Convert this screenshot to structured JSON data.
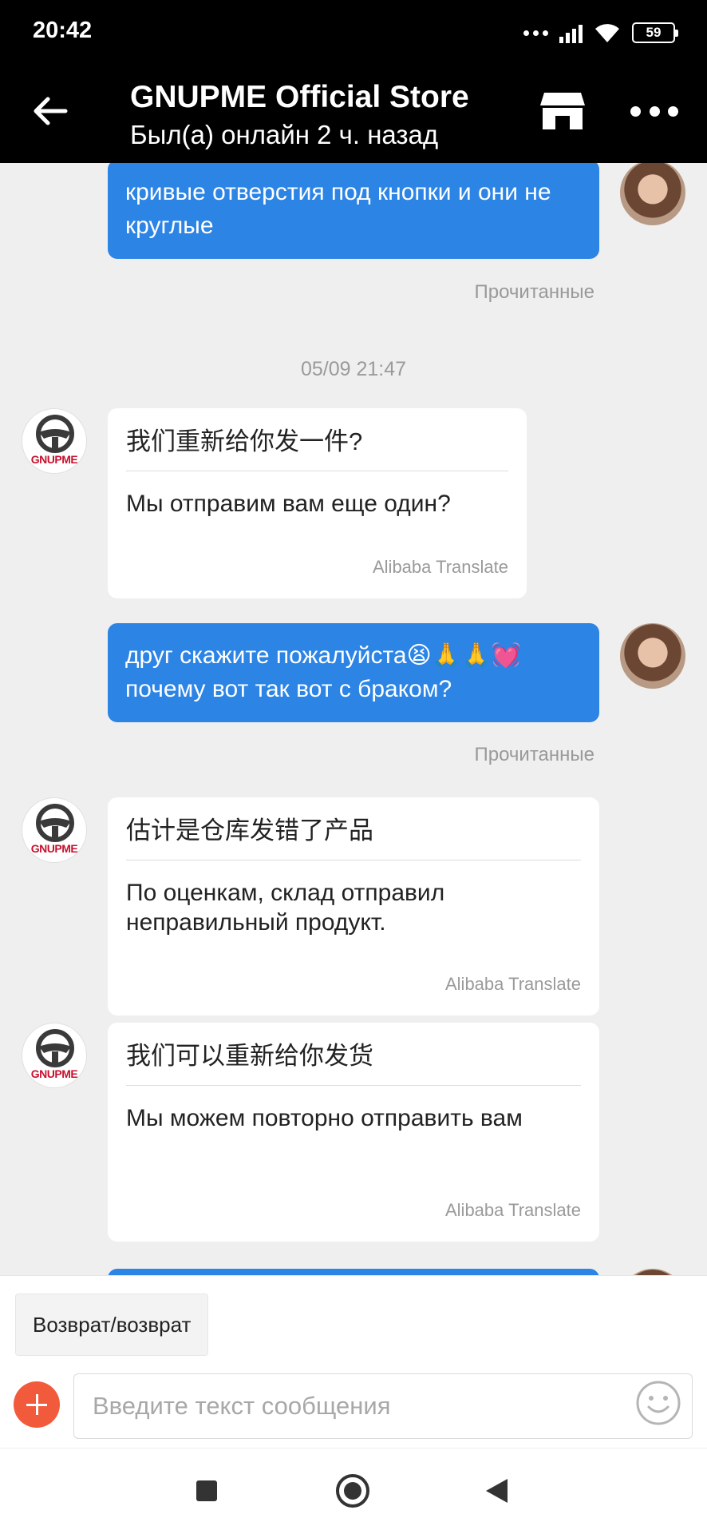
{
  "status_bar": {
    "time": "20:42",
    "battery": "59"
  },
  "header": {
    "title": "GNUPME Official Store",
    "subtitle": "Был(а) онлайн 2 ч. назад"
  },
  "store_brand": "GNUPME",
  "messages": [
    {
      "from": "user",
      "text": "кривые отверстия под кнопки и они не круглые",
      "status": "Прочитанные"
    },
    {
      "type": "timestamp",
      "text": "05/09 21:47"
    },
    {
      "from": "store",
      "original": "我们重新给你发一件?",
      "translation": "Мы отправим вам еще один?",
      "source": "Alibaba Translate"
    },
    {
      "from": "user",
      "text": "друг скажите пожалуйста😫🙏🙏💓 почему вот так вот с браком?",
      "status": "Прочитанные"
    },
    {
      "from": "store",
      "original": "估计是仓库发错了产品",
      "translation": "По оценкам, склад отправил неправильный продукт.",
      "source": "Alibaba Translate"
    },
    {
      "from": "store",
      "original": "我们可以重新给你发货",
      "translation": "Мы можем повторно отправить вам",
      "source": "Alibaba Translate"
    }
  ],
  "quick_reply": "Возврат/возврат",
  "input": {
    "placeholder": "Введите текст сообщения",
    "value": ""
  },
  "icons": [
    "back-arrow-icon",
    "store-icon",
    "more-icon",
    "plus-icon",
    "emoji-icon",
    "recent-apps-icon",
    "home-icon",
    "nav-back-icon"
  ],
  "colors": {
    "outgoing_bubble": "#2c84e5",
    "header_bg": "#000000",
    "plus_button": "#f25a3c",
    "chat_bg": "#efefef"
  }
}
